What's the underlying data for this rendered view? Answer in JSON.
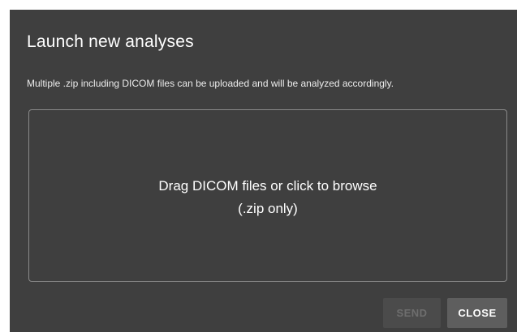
{
  "dialog": {
    "title": "Launch new analyses",
    "description": "Multiple .zip including DICOM files can be uploaded and will be analyzed accordingly.",
    "dropzone": {
      "primary_text": "Drag DICOM files or click to browse",
      "secondary_text": "(.zip only)"
    },
    "actions": {
      "send_label": "SEND",
      "send_disabled": true,
      "close_label": "CLOSE"
    }
  },
  "colors": {
    "dialog_background": "#3f3f3f",
    "page_background": "#ffffff",
    "dropzone_border": "#8a8a8a",
    "send_button_background": "#4b4b4b",
    "close_button_background": "#5e5e5e"
  }
}
